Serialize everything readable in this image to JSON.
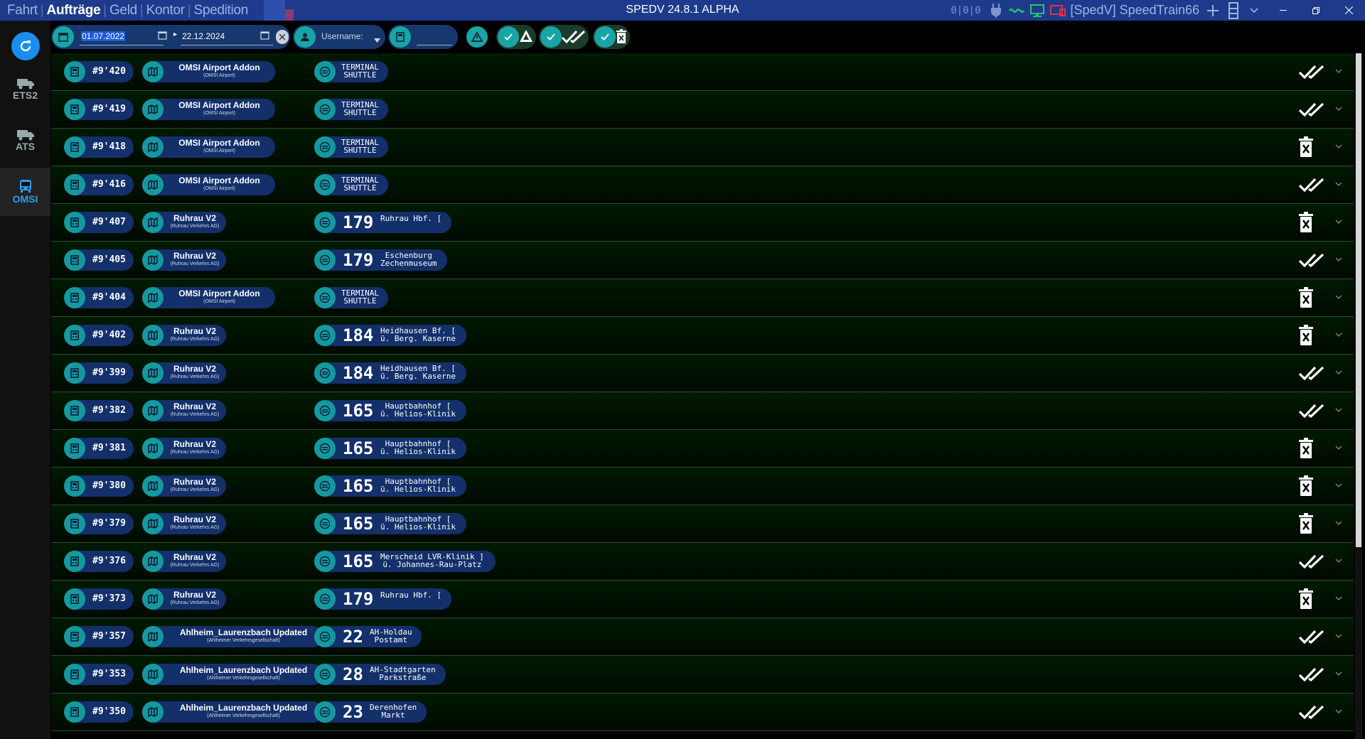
{
  "menu": {
    "items": [
      "Fahrt",
      "Aufträge",
      "Geld",
      "Kontor",
      "Spedition"
    ],
    "active": "Aufträge"
  },
  "app": {
    "title": "SPEDV 24.8.1 ALPHA"
  },
  "tray": {
    "counter": "0|0|0",
    "user": "[SpedV] SpeedTrain66"
  },
  "colors": {
    "titlebar": "#1d3b8a",
    "accent": "#1b8df0",
    "teal": "#149a9e",
    "pill": "#14306a",
    "delivered": "#ffffff",
    "cancelled": "#ffffff"
  },
  "sidebar": {
    "items": [
      {
        "label": "ETS2",
        "icon": "truck-icon"
      },
      {
        "label": "ATS",
        "icon": "truck-icon"
      },
      {
        "label": "OMSI",
        "icon": "bus-icon",
        "active": true
      }
    ]
  },
  "filter": {
    "date_from": "01.07.2022",
    "date_to": "22.12.2024",
    "username_label": "Username:",
    "search_value": ""
  },
  "orders": [
    {
      "id": "#9'420",
      "map": "OMSI Airport Addon",
      "sub": "(OMSI Airport)",
      "line": "",
      "dest": "TERMINAL\nSHUTTLE",
      "status": "delivered"
    },
    {
      "id": "#9'419",
      "map": "OMSI Airport Addon",
      "sub": "(OMSI Airport)",
      "line": "",
      "dest": "TERMINAL\nSHUTTLE",
      "status": "delivered"
    },
    {
      "id": "#9'418",
      "map": "OMSI Airport Addon",
      "sub": "(OMSI Airport)",
      "line": "",
      "dest": "TERMINAL\nSHUTTLE",
      "status": "cancelled"
    },
    {
      "id": "#9'416",
      "map": "OMSI Airport Addon",
      "sub": "(OMSI Airport)",
      "line": "",
      "dest": "TERMINAL\nSHUTTLE",
      "status": "delivered"
    },
    {
      "id": "#9'407",
      "map": "Ruhrau V2",
      "sub": "(Ruhrau Verkehrs AG)",
      "line": "179",
      "dest": "Ruhrau Hbf. [",
      "status": "cancelled"
    },
    {
      "id": "#9'405",
      "map": "Ruhrau V2",
      "sub": "(Ruhrau Verkehrs AG)",
      "line": "179",
      "dest": "Eschenburg\nZechenmuseum",
      "status": "delivered"
    },
    {
      "id": "#9'404",
      "map": "OMSI Airport Addon",
      "sub": "(OMSI Airport)",
      "line": "",
      "dest": "TERMINAL\nSHUTTLE",
      "status": "cancelled"
    },
    {
      "id": "#9'402",
      "map": "Ruhrau V2",
      "sub": "(Ruhrau Verkehrs AG)",
      "line": "184",
      "dest": "Heidhausen Bf. [\nü. Berg. Kaserne",
      "status": "cancelled"
    },
    {
      "id": "#9'399",
      "map": "Ruhrau V2",
      "sub": "(Ruhrau Verkehrs AG)",
      "line": "184",
      "dest": "Heidhausen Bf. [\nü. Berg. Kaserne",
      "status": "delivered"
    },
    {
      "id": "#9'382",
      "map": "Ruhrau V2",
      "sub": "(Ruhrau Verkehrs AG)",
      "line": "165",
      "dest": "Hauptbahnhof [\nü. Helios-Klinik",
      "status": "delivered"
    },
    {
      "id": "#9'381",
      "map": "Ruhrau V2",
      "sub": "(Ruhrau Verkehrs AG)",
      "line": "165",
      "dest": "Hauptbahnhof [\nü. Helios-Klinik",
      "status": "cancelled"
    },
    {
      "id": "#9'380",
      "map": "Ruhrau V2",
      "sub": "(Ruhrau Verkehrs AG)",
      "line": "165",
      "dest": "Hauptbahnhof [\nü. Helios-Klinik",
      "status": "cancelled"
    },
    {
      "id": "#9'379",
      "map": "Ruhrau V2",
      "sub": "(Ruhrau Verkehrs AG)",
      "line": "165",
      "dest": "Hauptbahnhof [\nü. Helios-Klinik",
      "status": "cancelled"
    },
    {
      "id": "#9'376",
      "map": "Ruhrau V2",
      "sub": "(Ruhrau Verkehrs AG)",
      "line": "165",
      "dest": "Merscheid LVR-Klinik ]\nü. Johannes-Rau-Platz",
      "status": "delivered"
    },
    {
      "id": "#9'373",
      "map": "Ruhrau V2",
      "sub": "(Ruhrau Verkehrs AG)",
      "line": "179",
      "dest": "Ruhrau Hbf. [",
      "status": "cancelled"
    },
    {
      "id": "#9'357",
      "map": "Ahlheim_Laurenzbach Updated",
      "sub": "(Ahlheimer Verkehrsgesellschaft)",
      "line": "22",
      "dest": "AH-Holdau\nPostamt",
      "status": "delivered"
    },
    {
      "id": "#9'353",
      "map": "Ahlheim_Laurenzbach Updated",
      "sub": "(Ahlheimer Verkehrsgesellschaft)",
      "line": "28",
      "dest": "AH-Stadtgarten\nParkstraße",
      "status": "delivered"
    },
    {
      "id": "#9'350",
      "map": "Ahlheim_Laurenzbach Updated",
      "sub": "(Ahlheimer Verkehrsgesellschaft)",
      "line": "23",
      "dest": "Derenhofen\nMarkt",
      "status": "delivered"
    }
  ]
}
